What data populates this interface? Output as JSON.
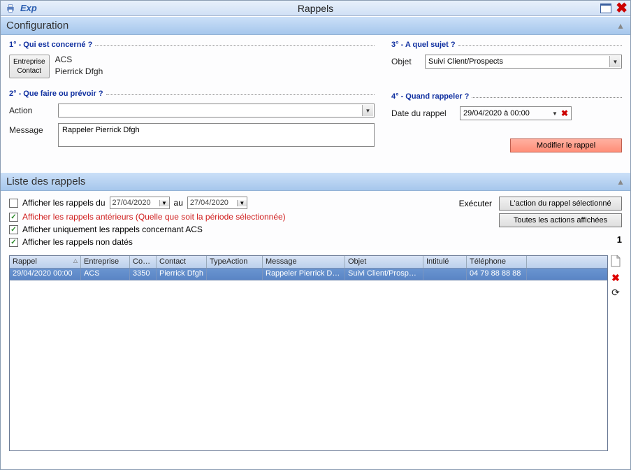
{
  "title": "Rappels",
  "brand": "Exp",
  "sections": {
    "config": "Configuration",
    "liste": "Liste des rappels"
  },
  "config": {
    "q1": {
      "legend": "1° - Qui est concerné ?",
      "button_line1": "Entreprise",
      "button_line2": "Contact",
      "entreprise": "ACS",
      "contact": "Pierrick Dfgh"
    },
    "q2": {
      "legend": "2° - Que faire ou prévoir ?",
      "action_label": "Action",
      "action_value": "",
      "message_label": "Message",
      "message_value": "Rappeler Pierrick Dfgh"
    },
    "q3": {
      "legend": "3° - A quel sujet ?",
      "objet_label": "Objet",
      "objet_value": "Suivi Client/Prospects"
    },
    "q4": {
      "legend": "4° - Quand rappeler ?",
      "date_label": "Date du rappel",
      "date_value": "29/04/2020 à 00:00"
    },
    "mod_btn": "Modifier le rappel"
  },
  "liste": {
    "chk_du_label": "Afficher les rappels du",
    "date_from": "27/04/2020",
    "au": "au",
    "date_to": "27/04/2020",
    "chk_ant": "Afficher les rappels antérieurs (Quelle que soit la période sélectionnée)",
    "chk_acs": "Afficher uniquement les rappels concernant ACS",
    "chk_nondates": "Afficher les rappels non datés",
    "exec_label": "Exécuter",
    "btn_sel": "L'action du rappel sélectionné",
    "btn_all": "Toutes les actions affichées",
    "count": "1"
  },
  "table": {
    "headers": {
      "rappel": "Rappel",
      "entreprise": "Entreprise",
      "cid": "Conta",
      "contact": "Contact",
      "type": "TypeAction",
      "msg": "Message",
      "obj": "Objet",
      "int": "Intitulé",
      "tel": "Téléphone"
    },
    "rows": [
      {
        "rappel": "29/04/2020 00:00",
        "entreprise": "ACS",
        "cid": "3350",
        "contact": "Pierrick Dfgh",
        "type": "",
        "msg": "Rappeler Pierrick Dfgh",
        "obj": "Suivi Client/Prospects",
        "int": "",
        "tel": "04 79 88 88 88"
      }
    ]
  }
}
